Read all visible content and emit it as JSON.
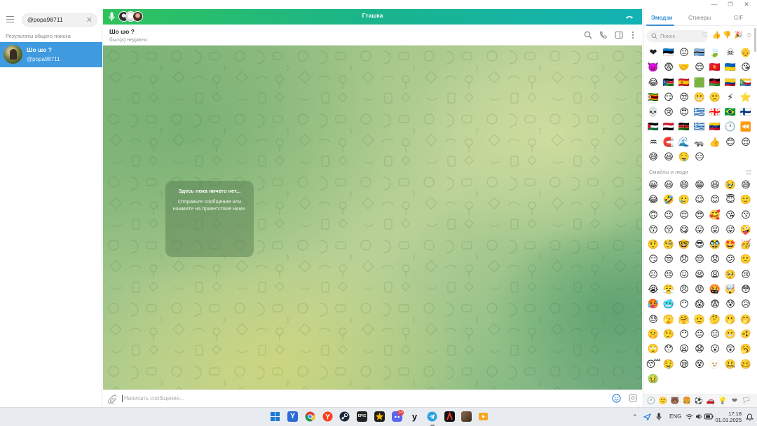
{
  "left_panel": {
    "search_value": "@popa98711",
    "global_results_label": "Результаты общего поиска",
    "chat_name": "Шо шо ?",
    "chat_username": "@popa98711"
  },
  "call_bar": {
    "title": "Гташка",
    "accent_color": "#1ab48c"
  },
  "chat_header": {
    "title": "Шо шо ?",
    "status": "был(а) недавно"
  },
  "empty_state": {
    "title": "Здесь пока ничего нет...",
    "text": "Отправьте сообщение или нажмите на приветствие ниже."
  },
  "composer": {
    "placeholder": "Написать сообщение..."
  },
  "emoji_panel": {
    "tabs": [
      "Эмодзи",
      "Стикеры",
      "GIF"
    ],
    "active_tab": "Эмодзи",
    "search_placeholder": "Поиск",
    "recent_emojis": [
      "❤",
      "🇪🇪",
      "😐",
      "🇧🇼",
      "🍃",
      "☠",
      "👴",
      "👿",
      "😨",
      "🤝",
      "😌",
      "🇰🇬",
      "🇺🇦",
      "😘",
      "😂",
      "🇸🇸",
      "🇪🇸",
      "🟩",
      "🇲🇼",
      "🇨🇴",
      "🇰🇲",
      "🇿🇼",
      "😏",
      "😒",
      "😬",
      "🙁",
      "⚡",
      "⭐",
      "💀",
      "😢",
      "😍",
      "🇬🇷",
      "🇬🇪",
      "🇧🇷",
      "🇫🇮",
      "🇵🇸",
      "🇾🇪",
      "🇰🇪",
      "🇬🇷",
      "🇻🇪",
      "🕐",
      "⏪",
      "♒",
      "🧲",
      "🌊",
      "🦡",
      "👍",
      "😊",
      "😌",
      "😅",
      "😃",
      "🤤",
      "😑"
    ],
    "section_title": "Смайлы и люди",
    "people_emojis": [
      "😀",
      "😃",
      "😄",
      "😁",
      "😆",
      "🥹",
      "😅",
      "😂",
      "🤣",
      "🥲",
      "☺",
      "😊",
      "😇",
      "🙂",
      "🙃",
      "😉",
      "😌",
      "😍",
      "🥰",
      "😘",
      "😗",
      "😙",
      "😚",
      "😋",
      "😛",
      "😝",
      "😜",
      "🤪",
      "🤨",
      "🧐",
      "🤓",
      "😎",
      "🥸",
      "🤩",
      "🥳",
      "😏",
      "😒",
      "😞",
      "😔",
      "😟",
      "😕",
      "🙁",
      "☹",
      "😣",
      "😖",
      "😫",
      "😩",
      "🥺",
      "😢",
      "😭",
      "😤",
      "😠",
      "😡",
      "🤬",
      "🤯",
      "😳",
      "🥵",
      "🥶",
      "😶",
      "😱",
      "😨",
      "😰",
      "😥",
      "😓",
      "🫣",
      "🤗",
      "🫡",
      "🤔",
      "🫢",
      "🤭",
      "🤫",
      "🤥",
      "😶",
      "😐",
      "😑",
      "😬",
      "🫨",
      "🙄",
      "😯",
      "😦",
      "😧",
      "😮",
      "😲",
      "🥱",
      "😴",
      "🤤",
      "😪",
      "😵",
      "🫥",
      "🤐",
      "🥴",
      "🤢"
    ],
    "bottom_categories": [
      "🕐",
      "🙂",
      "🐻",
      "🍔",
      "⚽",
      "🚗",
      "💡",
      "❤",
      "🏳"
    ]
  },
  "taskbar": {
    "apps": [
      "windows",
      "yandex-browser-y",
      "chrome",
      "yandex",
      "steam",
      "epic-games",
      "spotify-like",
      "discord",
      "vk",
      "telegram",
      "app-red",
      "app-photo",
      "app-media"
    ],
    "discord_badge": "10",
    "lang": "ENG",
    "time": "17:18",
    "date": "01.01.2025"
  }
}
